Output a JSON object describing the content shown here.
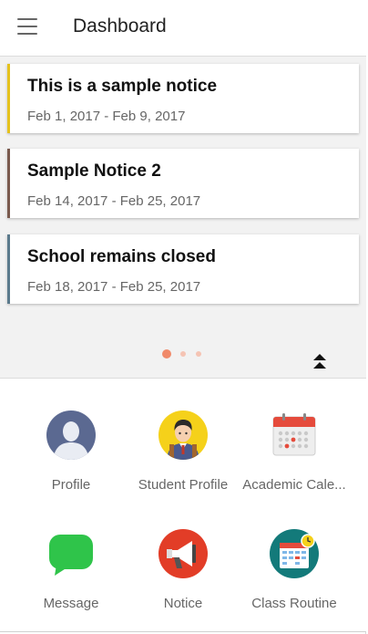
{
  "appbar": {
    "title": "Dashboard",
    "menu_icon": "hamburger-menu-icon"
  },
  "notices": [
    {
      "title": "This is a sample notice",
      "dates": "Feb 1, 2017 - Feb 9, 2017",
      "accent": "#e5c21d"
    },
    {
      "title": "Sample Notice 2",
      "dates": "Feb 14, 2017 - Feb 25, 2017",
      "accent": "#7a5a4e"
    },
    {
      "title": "School remains closed",
      "dates": "Feb 18, 2017 - Feb 25, 2017",
      "accent": "#5b7a8c"
    }
  ],
  "pager": {
    "active_color": "#f08a6a",
    "inactive_color": "#f5c4b4",
    "page_count": 3,
    "active_index": 0
  },
  "collapse_icon": "double-chevron-up-icon",
  "shortcuts": [
    {
      "label": "Profile",
      "icon": "profile-avatar-icon"
    },
    {
      "label": "Student Profile",
      "icon": "student-avatar-icon"
    },
    {
      "label": "Academic Cale...",
      "icon": "calendar-icon"
    },
    {
      "label": "Message",
      "icon": "message-bubble-icon"
    },
    {
      "label": "Notice",
      "icon": "megaphone-icon"
    },
    {
      "label": "Class Routine",
      "icon": "class-routine-icon"
    }
  ]
}
